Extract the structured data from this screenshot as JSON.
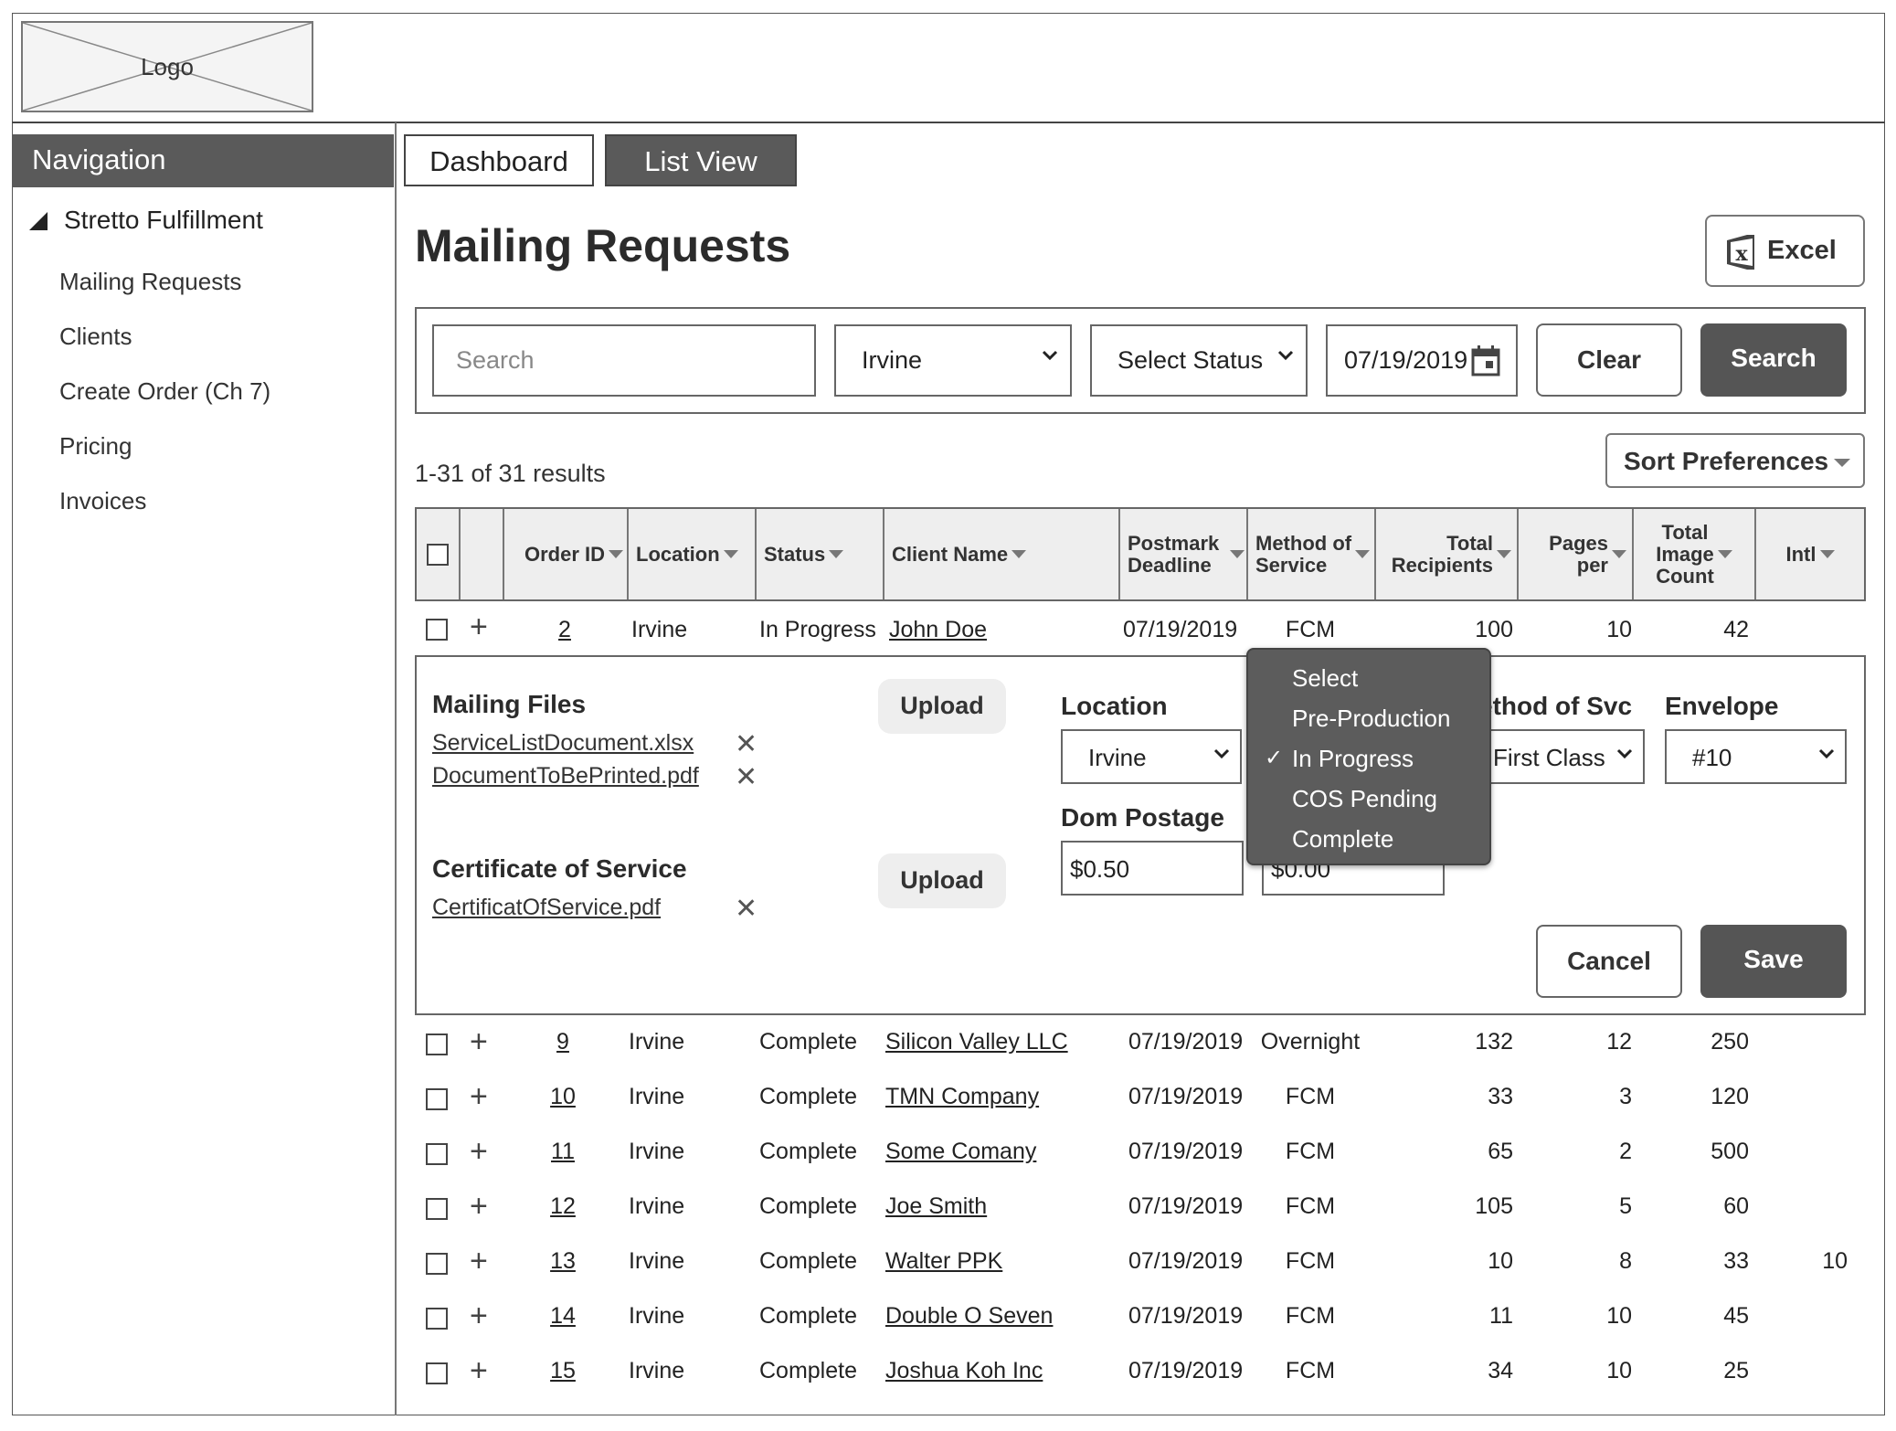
{
  "logo": {
    "text": "Logo"
  },
  "nav": {
    "header": "Navigation",
    "group": "Stretto Fulfillment",
    "items": [
      "Mailing Requests",
      "Clients",
      "Create Order (Ch 7)",
      "Pricing",
      "Invoices"
    ]
  },
  "tabs": {
    "dashboard": "Dashboard",
    "list_view": "List View"
  },
  "page": {
    "title": "Mailing Requests",
    "excel_label": "Excel"
  },
  "filters": {
    "search_placeholder": "Search",
    "location": "Irvine",
    "status": "Select Status",
    "date": "07/19/2019",
    "clear_label": "Clear",
    "search_label": "Search"
  },
  "results": {
    "count_text": "1-31 of 31 results",
    "sort_label": "Sort Preferences"
  },
  "table": {
    "columns": {
      "order_id": "Order ID",
      "location": "Location",
      "status": "Status",
      "client_name": "Client Name",
      "postmark_1": "Postmark",
      "postmark_2": "Deadline",
      "method_1": "Method of",
      "method_2": "Service",
      "total_1": "Total",
      "total_2": "Recipients",
      "pages_1": "Pages",
      "pages_2": "per",
      "image_1": "Total",
      "image_2": "Image",
      "image_3": "Count",
      "intl": "Intl"
    },
    "expanded_row": {
      "id": "2",
      "location": "Irvine",
      "status": "In Progress",
      "client": "John Doe",
      "deadline": "07/19/2019",
      "method": "FCM",
      "recipients": "100",
      "pages": "10",
      "images": "42",
      "intl": ""
    },
    "rows": [
      {
        "id": "9",
        "location": "Irvine",
        "status": "Complete",
        "client": "Silicon Valley LLC",
        "deadline": "07/19/2019",
        "method": "Overnight",
        "recipients": "132",
        "pages": "12",
        "images": "250",
        "intl": ""
      },
      {
        "id": "10",
        "location": "Irvine",
        "status": "Complete",
        "client": "TMN Company",
        "deadline": "07/19/2019",
        "method": "FCM",
        "recipients": "33",
        "pages": "3",
        "images": "120",
        "intl": ""
      },
      {
        "id": "11",
        "location": "Irvine",
        "status": "Complete",
        "client": "Some Comany",
        "deadline": "07/19/2019",
        "method": "FCM",
        "recipients": "65",
        "pages": "2",
        "images": "500",
        "intl": ""
      },
      {
        "id": "12",
        "location": "Irvine",
        "status": "Complete",
        "client": "Joe Smith",
        "deadline": "07/19/2019",
        "method": "FCM",
        "recipients": "105",
        "pages": "5",
        "images": "60",
        "intl": ""
      },
      {
        "id": "13",
        "location": "Irvine",
        "status": "Complete",
        "client": "Walter PPK",
        "deadline": "07/19/2019",
        "method": "FCM",
        "recipients": "10",
        "pages": "8",
        "images": "33",
        "intl": "10"
      },
      {
        "id": "14",
        "location": "Irvine",
        "status": "Complete",
        "client": "Double O Seven",
        "deadline": "07/19/2019",
        "method": "FCM",
        "recipients": "11",
        "pages": "10",
        "images": "45",
        "intl": ""
      },
      {
        "id": "15",
        "location": "Irvine",
        "status": "Complete",
        "client": "Joshua Koh Inc",
        "deadline": "07/19/2019",
        "method": "FCM",
        "recipients": "34",
        "pages": "10",
        "images": "25",
        "intl": ""
      }
    ]
  },
  "panel": {
    "mailing_files_label": "Mailing Files",
    "files": [
      "ServiceListDocument.xlsx",
      "DocumentToBePrinted.pdf"
    ],
    "upload_label": "Upload",
    "cos_label": "Certificate of Service",
    "cos_file": "CertificatOfService.pdf",
    "location_label": "Location",
    "location_value": "Irvine",
    "method_label": "ethod of Svc",
    "method_value": "First Class",
    "envelope_label": "Envelope",
    "envelope_value": "#10",
    "dom_postage_label": "Dom Postage",
    "dom_postage_value": "$0.50",
    "other_postage_value": "$0.00",
    "cancel_label": "Cancel",
    "save_label": "Save"
  },
  "status_dropdown": {
    "options": [
      "Select",
      "Pre-Production",
      "In Progress",
      "COS Pending",
      "Complete"
    ],
    "selected": "In Progress"
  },
  "icons": [
    "excel-icon",
    "calendar-icon",
    "chevron-down-icon",
    "caret-down-icon",
    "plus-icon",
    "close-icon",
    "check-icon",
    "triangle-icon"
  ]
}
